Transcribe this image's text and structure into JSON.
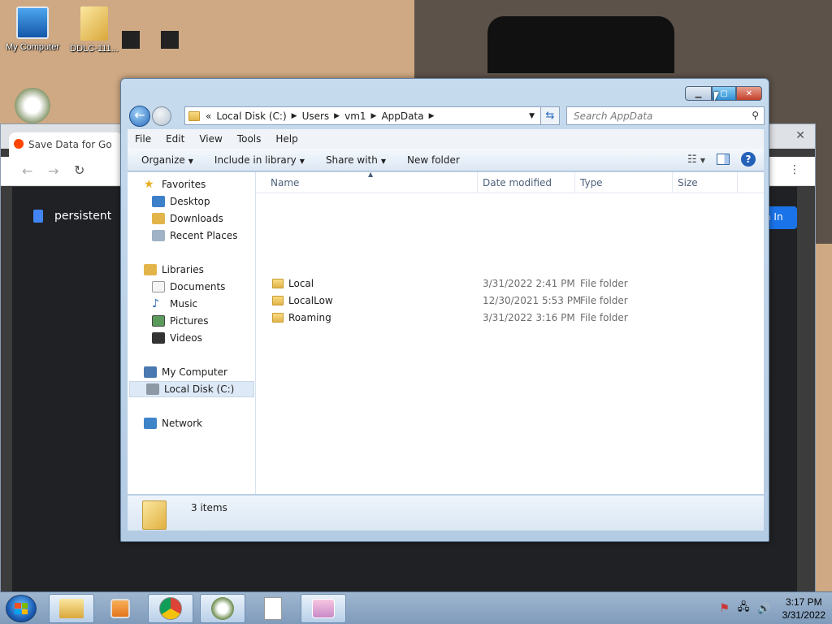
{
  "desktop": {
    "icons": [
      {
        "label": "My Computer",
        "icon": "computer-icon"
      },
      {
        "label": "DDLC-111...",
        "icon": "folder-icon"
      }
    ]
  },
  "chrome": {
    "tab_title": "Save Data for Go",
    "page_text": "persistent",
    "sign_in_partial": "n In"
  },
  "explorer": {
    "address": {
      "chevrons": "«",
      "crumbs": [
        "Local Disk (C:)",
        "Users",
        "vm1",
        "AppData"
      ]
    },
    "search_placeholder": "Search AppData",
    "menu": [
      "File",
      "Edit",
      "View",
      "Tools",
      "Help"
    ],
    "commands": {
      "organize": "Organize",
      "include": "Include in library",
      "share": "Share with",
      "new_folder": "New folder"
    },
    "nav": {
      "favorites": "Favorites",
      "desktop": "Desktop",
      "downloads": "Downloads",
      "recent": "Recent Places",
      "libraries": "Libraries",
      "documents": "Documents",
      "music": "Music",
      "pictures": "Pictures",
      "videos": "Videos",
      "my_computer": "My Computer",
      "local_disk": "Local Disk (C:)",
      "network": "Network"
    },
    "columns": {
      "name": "Name",
      "date": "Date modified",
      "type": "Type",
      "size": "Size"
    },
    "files": [
      {
        "name": "Local",
        "date": "3/31/2022 2:41 PM",
        "type": "File folder"
      },
      {
        "name": "LocalLow",
        "date": "12/30/2021 5:53 PM",
        "type": "File folder"
      },
      {
        "name": "Roaming",
        "date": "3/31/2022 3:16 PM",
        "type": "File folder"
      }
    ],
    "item_count": "3 items"
  },
  "taskbar": {
    "time": "3:17 PM",
    "date": "3/31/2022"
  }
}
